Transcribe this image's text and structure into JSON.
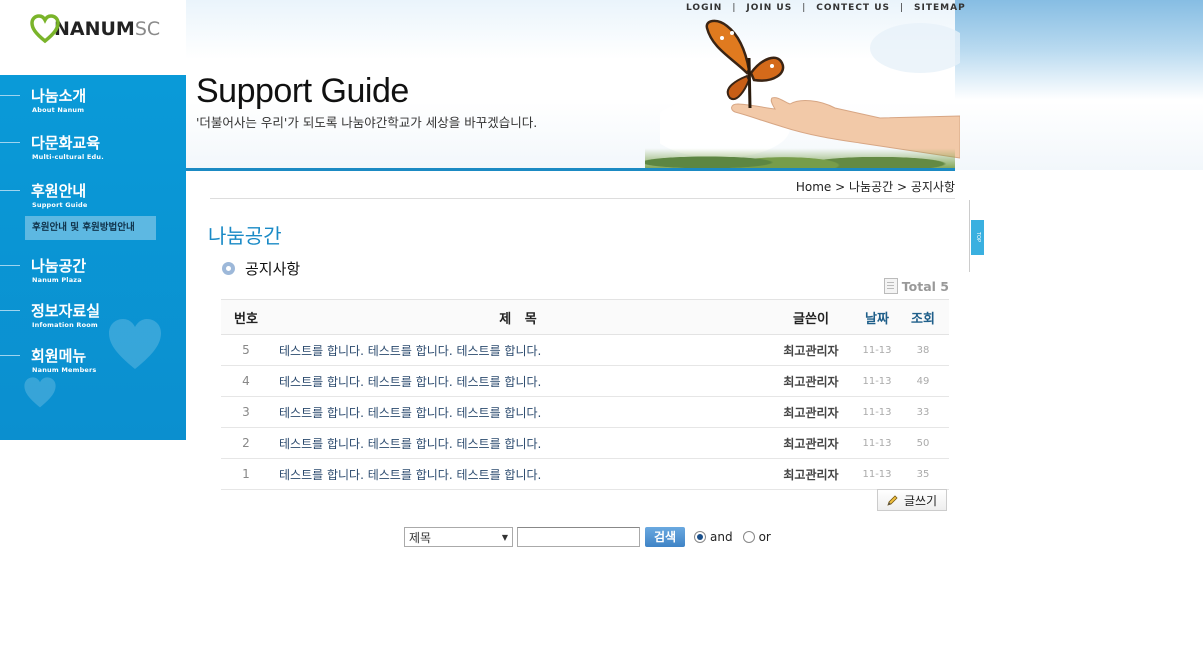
{
  "brand": {
    "logo_main": "NANUM",
    "logo_suffix": "SC"
  },
  "top_links": [
    "LOGIN",
    "JOIN US",
    "CONTECT US",
    "SITEMAP"
  ],
  "banner": {
    "title": "Support Guide",
    "subtitle": "'더불어사는 우리'가 되도록 나눔야간학교가 세상을 바꾸겠습니다."
  },
  "sidebar": {
    "items": [
      {
        "ko": "나눔소개",
        "en": "About Nanum"
      },
      {
        "ko": "다문화교육",
        "en": "Multi-cultural Edu."
      },
      {
        "ko": "후원안내",
        "en": "Support Guide"
      },
      {
        "ko": "나눔공간",
        "en": "Nanum Plaza"
      },
      {
        "ko": "정보자료실",
        "en": "Infomation Room"
      },
      {
        "ko": "회원메뉴",
        "en": "Nanum Members"
      }
    ],
    "sub_item": "후원안내 및 후원방법안내"
  },
  "breadcrumb": "Home > 나눔공간 > 공지사항",
  "top_button": "TOP",
  "page_title": "나눔공간",
  "sub_title": "공지사항",
  "total_label": "Total 5",
  "table": {
    "headers": {
      "num": "번호",
      "subject": "제   목",
      "writer": "글쓴이",
      "date": "날짜",
      "hit": "조회"
    },
    "rows": [
      {
        "num": "5",
        "subject": "테스트를 합니다. 테스트를 합니다. 테스트를 합니다.",
        "writer": "최고관리자",
        "date": "11-13",
        "hit": "38"
      },
      {
        "num": "4",
        "subject": "테스트를 합니다. 테스트를 합니다. 테스트를 합니다.",
        "writer": "최고관리자",
        "date": "11-13",
        "hit": "49"
      },
      {
        "num": "3",
        "subject": "테스트를 합니다. 테스트를 합니다. 테스트를 합니다.",
        "writer": "최고관리자",
        "date": "11-13",
        "hit": "33"
      },
      {
        "num": "2",
        "subject": "테스트를 합니다. 테스트를 합니다. 테스트를 합니다.",
        "writer": "최고관리자",
        "date": "11-13",
        "hit": "50"
      },
      {
        "num": "1",
        "subject": "테스트를 합니다. 테스트를 합니다. 테스트를 합니다.",
        "writer": "최고관리자",
        "date": "11-13",
        "hit": "35"
      }
    ]
  },
  "write_button": "글쓰기",
  "search": {
    "select_value": "제목",
    "input_value": "",
    "button": "검색",
    "radio_and": "and",
    "radio_or": "or",
    "selected": "and"
  },
  "colors": {
    "sidebar": "#0a9ad8",
    "accent": "#1a8ac6",
    "banner_line": "#1b8ac3"
  }
}
